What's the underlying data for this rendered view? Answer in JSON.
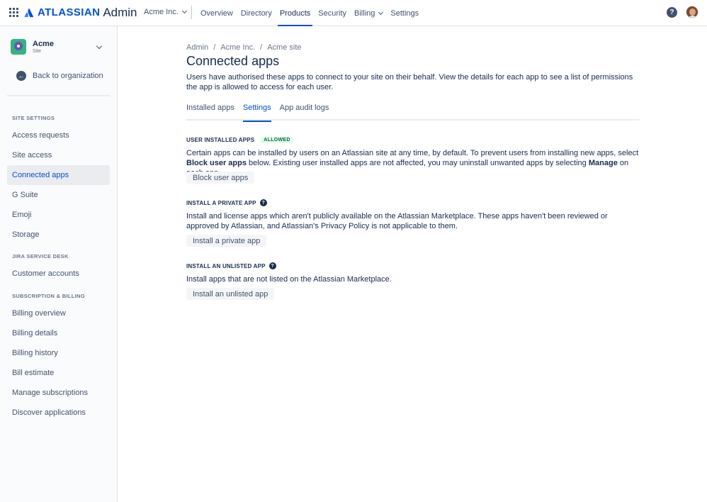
{
  "topbar": {
    "logo_word": "ATLASSIAN",
    "logo_product": "Admin",
    "org": "Acme Inc.",
    "nav": [
      {
        "label": "Overview"
      },
      {
        "label": "Directory"
      },
      {
        "label": "Products"
      },
      {
        "label": "Security"
      },
      {
        "label": "Billing"
      },
      {
        "label": "Settings"
      }
    ],
    "active_nav": "Products",
    "help_glyph": "?",
    "brand_color": "#0052cc"
  },
  "sidebar": {
    "site_name": "Acme",
    "site_sub": "Site",
    "back_label": "Back to organization",
    "sections": [
      {
        "title": "SITE SETTINGS",
        "items": [
          "Access requests",
          "Site access",
          "Connected apps",
          "G Suite",
          "Emoji",
          "Storage"
        ]
      },
      {
        "title": "JIRA SERVICE DESK",
        "items": [
          "Customer accounts"
        ]
      },
      {
        "title": "SUBSCRIPTION & BILLING",
        "items": [
          "Billing overview",
          "Billing details",
          "Billing history",
          "Bill estimate",
          "Manage subscriptions",
          "Discover applications"
        ]
      }
    ],
    "active_item": "Connected apps"
  },
  "main": {
    "breadcrumb": [
      "Admin",
      "Acme Inc.",
      "Acme site"
    ],
    "breadcrumb_sep": "/",
    "title": "Connected apps",
    "description": "Users have authorised these apps to connect to your site on their behalf. View the details for each app to see a list of permissions the app is allowed to access for each user.",
    "tabs": [
      "Installed apps",
      "Settings",
      "App audit logs"
    ],
    "active_tab": "Settings",
    "sections": {
      "user_installed": {
        "heading": "USER INSTALLED APPS",
        "lozenge": "ALLOWED",
        "text_1": "Certain apps can be installed by users on an Atlassian site at any time, by default. To prevent users from installing new apps, select ",
        "bold_1": "Block user apps",
        "text_2": " below. Existing user installed apps are not affected, you may uninstall unwanted apps by selecting ",
        "bold_2": "Manage",
        "text_3": " on each app.",
        "button": "Block user apps"
      },
      "private_app": {
        "heading": "INSTALL A PRIVATE APP",
        "text": "Install and license apps which aren't publicly available on the Atlassian Marketplace. These apps haven't been reviewed or approved by Atlassian, and Atlassian's Privacy Policy is not applicable to them.",
        "button": "Install a private app"
      },
      "unlisted_app": {
        "heading": "INSTALL AN UNLISTED APP",
        "text": "Install apps that are not listed on the Atlassian Marketplace.",
        "button": "Install an unlisted app"
      }
    },
    "help_glyph": "?"
  },
  "colors": {
    "accent": "#0052cc",
    "lozenge_bg": "#e3fcef",
    "lozenge_text": "#006644"
  }
}
